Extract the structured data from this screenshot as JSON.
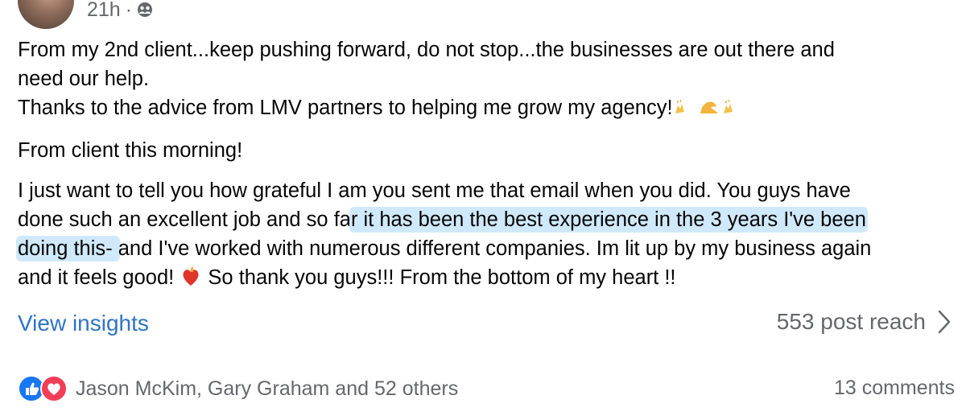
{
  "post": {
    "time": "21h",
    "separator": "·",
    "audience_icon": "friends-icon",
    "paragraphs": {
      "p1_line1": "From my 2nd client...keep pushing forward, do not stop...the businesses are out there and",
      "p1_line2": "need our help.",
      "p2": "Thanks to the advice from LMV partners to helping me grow my agency!",
      "p3": "From client this morning!",
      "p4_line1": "I just want to tell you how grateful I am you sent me that email when you did. You guys have",
      "p4_line2_pre": "done such an excellent job and so fa",
      "p4_line2_hl": "r it has been the best experience in the 3 years I've been",
      "p4_line3_hl": "doing this- ",
      "p4_line3_post": "and I've worked with numerous different companies. Im lit up by my business again",
      "p4_line4_pre": "and it feels good!",
      "p4_line4_post": "So thank you guys!!! From the bottom of my heart !!"
    },
    "highlight_color": "#cfe9fb"
  },
  "insights": {
    "view_label": "View insights",
    "reach_label": "553 post reach"
  },
  "reactions": {
    "icons": [
      "like-icon",
      "love-icon"
    ],
    "names": "Jason McKim, Gary Graham and 52 others",
    "comments": "13 comments"
  },
  "colors": {
    "link": "#2f74c6",
    "secondary": "#65676b",
    "like": "#1877f2",
    "love": "#f33e58"
  }
}
